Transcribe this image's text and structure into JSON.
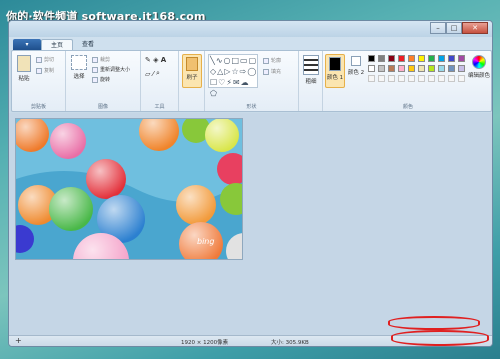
{
  "watermark": "你的·软件频道 software.it168.com",
  "window": {
    "controls": {
      "minimize": "–",
      "maximize": "□",
      "close": "✕"
    }
  },
  "tabs": {
    "app_menu": "▾",
    "home": "主页",
    "view": "查看"
  },
  "ribbon": {
    "clipboard": {
      "paste": "粘贴",
      "cut": "剪切",
      "copy": "复制",
      "label": "剪贴板"
    },
    "image": {
      "select": "选择",
      "crop": "裁剪",
      "resize": "重新调整大小",
      "rotate": "旋转",
      "label": "图像"
    },
    "tools": {
      "label": "工具"
    },
    "brushes": {
      "label": "刷子"
    },
    "shapes": {
      "outline": "轮廓",
      "fill": "填充",
      "label": "形状"
    },
    "size": {
      "label": "粗细"
    },
    "colors": {
      "color1": "颜色 1",
      "color2": "颜色 2",
      "edit": "编辑颜色",
      "label": "颜色",
      "palette_row1": [
        "#000000",
        "#7f7f7f",
        "#880015",
        "#ed1c24",
        "#ff7f27",
        "#fff200",
        "#22b14c",
        "#00a2e8",
        "#3f48cc",
        "#a349a4"
      ],
      "palette_row2": [
        "#ffffff",
        "#c3c3c3",
        "#b97a57",
        "#ffaec9",
        "#ffc90e",
        "#efe4b0",
        "#b5e61d",
        "#99d9ea",
        "#7092be",
        "#c8bfe7"
      ],
      "accent": "#000000"
    }
  },
  "canvas": {
    "watermark_text": "bing"
  },
  "status": {
    "add": "+",
    "dimensions": "1920 × 1200像素",
    "size": "大小: 305.9KB"
  }
}
